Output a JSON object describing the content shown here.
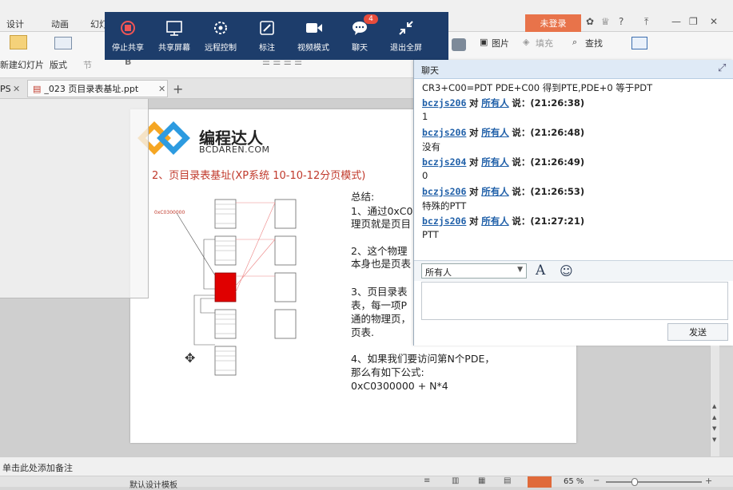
{
  "menu": {
    "tabs": [
      "设计",
      "动画",
      "幻灯"
    ],
    "login": "未登录"
  },
  "ribbon": {
    "new_slide": "新建幻灯片",
    "layout": "版式",
    "section": "节",
    "picture": "图片",
    "fill": "填充",
    "find": "查找"
  },
  "tabs": {
    "left_fragment": "PS",
    "doc_name": "_023 页目录表基址.ppt"
  },
  "share_bar": {
    "buttons": [
      {
        "label": "停止共享",
        "icon": "stop-circle-icon"
      },
      {
        "label": "共享屏幕",
        "icon": "share-screen-icon"
      },
      {
        "label": "远程控制",
        "icon": "remote-control-icon"
      },
      {
        "label": "标注",
        "icon": "annotate-icon"
      },
      {
        "label": "视频模式",
        "icon": "video-camera-icon"
      },
      {
        "label": "聊天",
        "icon": "chat-bubble-icon",
        "badge": "4"
      },
      {
        "label": "退出全屏",
        "icon": "exit-fullscreen-icon"
      }
    ]
  },
  "slide": {
    "logo_text": "编程达人",
    "logo_sub": "BCDAREN.COM",
    "title": "2、页目录表基址(XP系统 10-10-12分页模式)",
    "addr_label": "0xC0300000",
    "summary": {
      "heading": "总结:",
      "p1a": "1、通过0xC0",
      "p1b": "理页就是页目",
      "p2a": "2、这个物理",
      "p2b": "本身也是页表",
      "p3a": "3、页目录表",
      "p3b": "表，每一项P",
      "p3c": "通的物理页，",
      "p3d": "页表.",
      "p4a": "4、如果我们要访问第N个PDE，",
      "p4b": "那么有如下公式:",
      "p4c": "0xC0300000 + N*4"
    }
  },
  "chat": {
    "title": "聊天",
    "first_line": "CR3+C00=PDT  PDE+C00 得到PTE,PDE+0 等于PDT",
    "to_word": "对",
    "says_word": "说：",
    "target": "所有人",
    "messages": [
      {
        "sender": "bczjs206",
        "time": "(21:26:38)",
        "text": "1"
      },
      {
        "sender": "bczjs206",
        "time": "(21:26:48)",
        "text": "没有"
      },
      {
        "sender": "bczjs204",
        "time": "(21:26:49)",
        "text": "0"
      },
      {
        "sender": "bczjs206",
        "time": "(21:26:53)",
        "text": "特殊的PTT"
      },
      {
        "sender": "bczjs206",
        "time": "(21:27:21)",
        "text": "PTT"
      }
    ],
    "recipient": "所有人",
    "send": "发送"
  },
  "notes": {
    "placeholder": "单击此处添加备注"
  },
  "status": {
    "template": "默认设计模板",
    "zoom": "65 %"
  },
  "colors": {
    "share_bar": "#1d3d6b",
    "login_badge": "#e8734a",
    "chat_header": "#dfeaf6",
    "sender_link": "#1f5fa8",
    "title_red": "#c0392b"
  }
}
